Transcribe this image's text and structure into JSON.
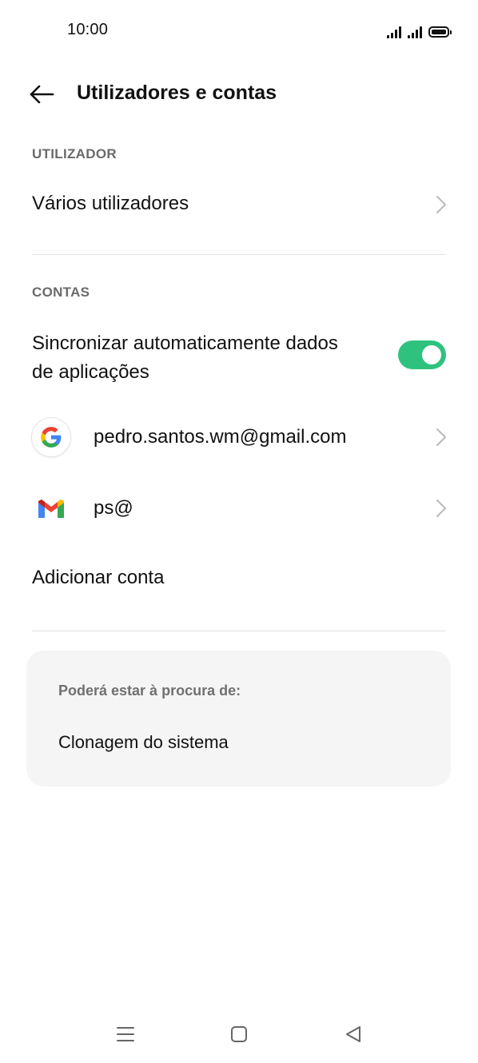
{
  "status_bar": {
    "time": "10:00",
    "icons": [
      "signal-icon",
      "signal-icon",
      "battery-icon"
    ]
  },
  "header": {
    "back_icon": "arrow-left-icon",
    "title": "Utilizadores e contas"
  },
  "sections": {
    "user": {
      "label": "UTILIZADOR",
      "items": [
        {
          "label": "Vários utilizadores",
          "icon": "chevron-right-icon"
        }
      ]
    },
    "accounts": {
      "label": "CONTAS",
      "auto_sync": {
        "line1": "Sincronizar automaticamente dados",
        "line2": "de aplicações",
        "enabled": true,
        "toggle_color": "#2ec27e"
      },
      "items": [
        {
          "label": "pedro.santos.wm@gmail.com",
          "icon": "google-icon"
        },
        {
          "label": "ps@",
          "icon": "gmail-icon"
        }
      ],
      "add_account": "Adicionar conta"
    }
  },
  "suggestions": {
    "title": "Poderá estar à procura de:",
    "items": [
      "Clonagem do sistema"
    ]
  },
  "nav_bar": {
    "icons": [
      "menu-icon",
      "home-icon",
      "back-triangle-icon"
    ]
  }
}
